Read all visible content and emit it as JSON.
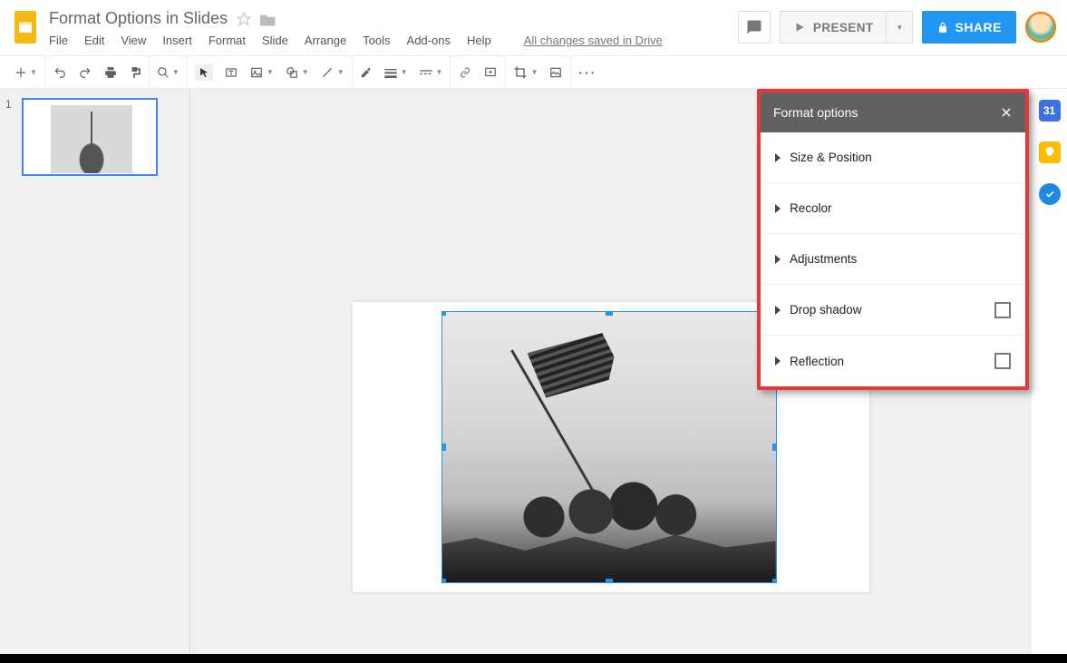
{
  "header": {
    "doc_title": "Format Options in Slides",
    "status": "All changes saved in Drive",
    "present_label": "PRESENT",
    "share_label": "SHARE"
  },
  "menu": {
    "file": "File",
    "edit": "Edit",
    "view": "View",
    "insert": "Insert",
    "format": "Format",
    "slide": "Slide",
    "arrange": "Arrange",
    "tools": "Tools",
    "addons": "Add-ons",
    "help": "Help"
  },
  "film": {
    "slide1_number": "1"
  },
  "panel": {
    "title": "Format options",
    "items": {
      "size_position": "Size & Position",
      "recolor": "Recolor",
      "adjustments": "Adjustments",
      "drop_shadow": "Drop shadow",
      "reflection": "Reflection"
    }
  },
  "rail": {
    "calendar": "31"
  }
}
